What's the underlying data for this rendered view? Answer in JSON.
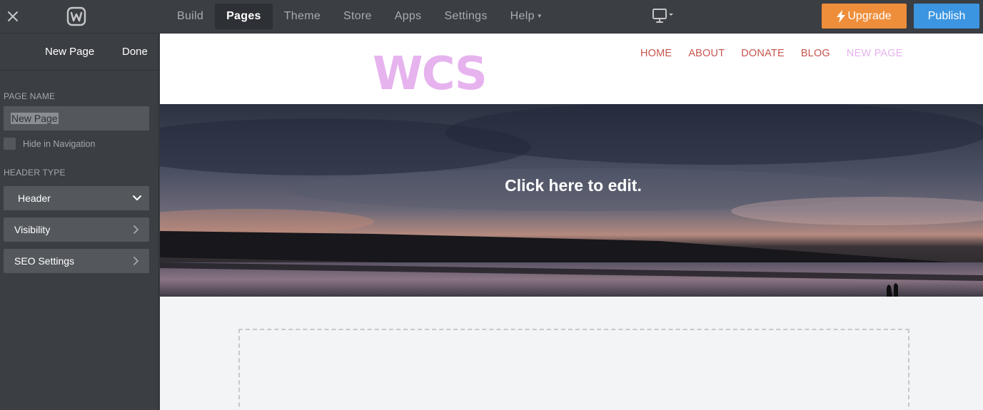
{
  "topbar": {
    "nav": [
      "Build",
      "Pages",
      "Theme",
      "Store",
      "Apps",
      "Settings",
      "Help"
    ],
    "active_nav": "Pages",
    "upgrade_label": "Upgrade",
    "publish_label": "Publish",
    "colors": {
      "upgrade": "#ef8e3a",
      "publish": "#3c95e0",
      "bar": "#3b3e43"
    }
  },
  "sidebar": {
    "title": "New Page",
    "done_label": "Done",
    "page_name_label": "PAGE NAME",
    "page_name_value": "New Page",
    "hide_nav_label": "Hide in Navigation",
    "header_type_label": "HEADER TYPE",
    "header_type_value": "Header",
    "visibility_label": "Visibility",
    "seo_label": "SEO Settings"
  },
  "site": {
    "logo_text": "WCS",
    "nav": [
      "HOME",
      "ABOUT",
      "DONATE",
      "BLOG",
      "NEW PAGE"
    ],
    "banner_text": "Click here to edit.",
    "colors": {
      "logo": "#e6b3ee",
      "nav": "#c7554e",
      "nav_current": "#e6b3ee"
    }
  }
}
